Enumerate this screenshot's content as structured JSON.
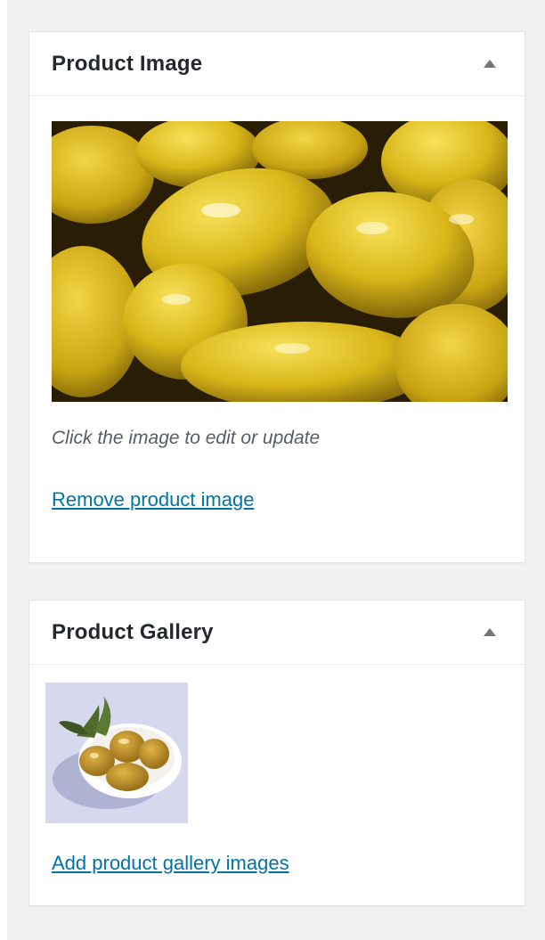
{
  "product_image": {
    "title": "Product Image",
    "hint": "Click the image to edit or update",
    "remove_label": "Remove product image"
  },
  "product_gallery": {
    "title": "Product Gallery",
    "add_label": "Add product gallery images"
  },
  "colors": {
    "background": "#f1f1f1",
    "panel": "#ffffff",
    "link": "#0073aa",
    "heading": "#23282d",
    "hint": "#555d66"
  },
  "icons": {
    "toggle": "triangle-up-icon"
  }
}
